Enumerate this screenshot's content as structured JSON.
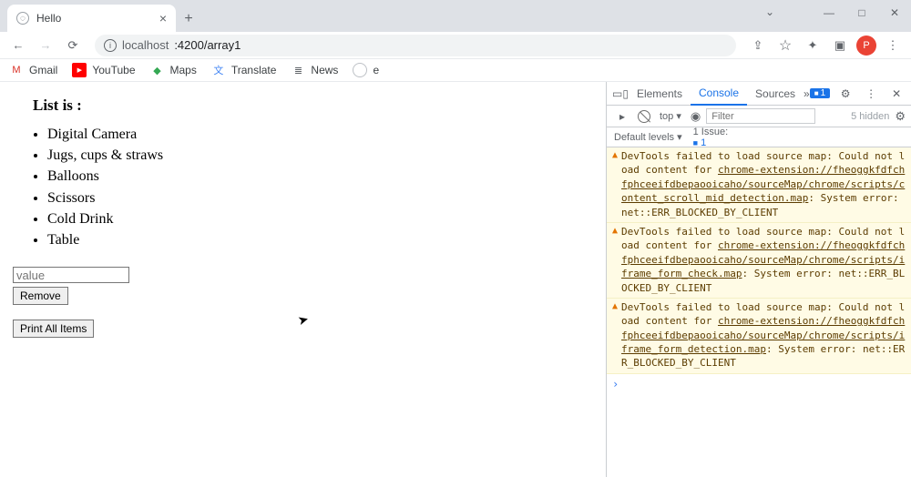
{
  "tab": {
    "title": "Hello"
  },
  "url": {
    "host": "localhost",
    "port_path": ":4200/array1"
  },
  "bookmarks": [
    {
      "label": "Gmail",
      "icon": "gmail"
    },
    {
      "label": "YouTube",
      "icon": "youtube"
    },
    {
      "label": "Maps",
      "icon": "maps"
    },
    {
      "label": "Translate",
      "icon": "translate"
    },
    {
      "label": "News",
      "icon": "news"
    },
    {
      "label": "e",
      "icon": "e"
    }
  ],
  "page": {
    "heading": "List is :",
    "items": [
      "Digital Camera",
      "Jugs, cups & straws",
      "Balloons",
      "Scissors",
      "Cold Drink",
      "Table"
    ],
    "input_placeholder": "value",
    "remove_label": "Remove",
    "print_label": "Print All Items"
  },
  "devtools": {
    "tabs": {
      "elements": "Elements",
      "console": "Console",
      "sources": "Sources"
    },
    "error_count": "1",
    "filter_top": "top ▾",
    "filter_placeholder": "Filter",
    "hidden_text": "5 hidden",
    "levels": "Default levels ▾",
    "issue_label": "1 Issue:",
    "issue_count": "1",
    "warnings": [
      {
        "pre": "DevTools failed to load source map: Could not load content for ",
        "link": "chrome-extension://fheoggkfdfchfphceeifdbepaooicaho/sourceMap/chrome/scripts/content_scroll_mid_detection.map",
        "post": ": System error: net::ERR_BLOCKED_BY_CLIENT"
      },
      {
        "pre": "DevTools failed to load source map: Could not load content for ",
        "link": "chrome-extension://fheoggkfdfchfphceeifdbepaooicaho/sourceMap/chrome/scripts/iframe_form_check.map",
        "post": ": System error: net::ERR_BLOCKED_BY_CLIENT"
      },
      {
        "pre": "DevTools failed to load source map: Could not load content for ",
        "link": "chrome-extension://fheoggkfdfchfphceeifdbepaooicaho/sourceMap/chrome/scripts/iframe_form_detection.map",
        "post": ": System error: net::ERR_BLOCKED_BY_CLIENT"
      }
    ]
  }
}
